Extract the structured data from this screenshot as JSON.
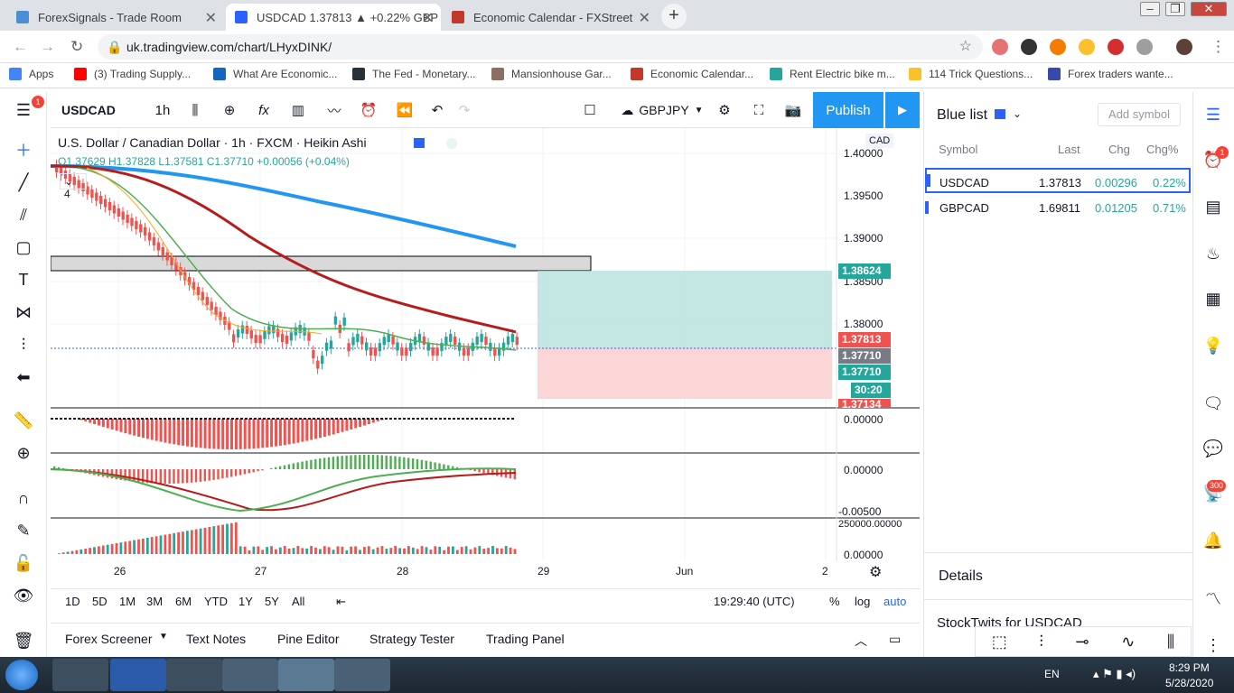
{
  "browser": {
    "tabs": [
      {
        "title": "ForexSignals - Trade Room",
        "active": false
      },
      {
        "title": "USDCAD 1.37813 ▲ +0.22% GBP",
        "active": true
      },
      {
        "title": "Economic Calendar - FXStreet",
        "active": false
      }
    ],
    "url": "uk.tradingview.com/chart/LHyxDINK/",
    "bookmarks": [
      "Apps",
      "(3) Trading Supply...",
      "What Are Economic...",
      "The Fed - Monetary...",
      "Mansionhouse Gar...",
      "Economic Calendar...",
      "Rent Electric bike m...",
      "114 Trick Questions...",
      "Forex traders wante..."
    ]
  },
  "toolbar": {
    "symbol": "USDCAD",
    "interval": "1h",
    "compare_symbol": "GBPJPY",
    "publish_label": "Publish"
  },
  "leftbar": {
    "alert_badge": "1"
  },
  "chart": {
    "title": "U.S. Dollar / Canadian Dollar · 1h · FXCM · Heikin Ashi",
    "ohlc": "O1.37629  H1.37828  L1.37581  C1.37710  +0.00056 (+0.04%)",
    "indicator_count": "4",
    "currency": "CAD",
    "price_ticks": [
      "1.40000",
      "1.39500",
      "1.39000",
      "1.38500",
      "1.38000"
    ],
    "price_labels": [
      {
        "text": "1.38624",
        "color": "#26a69a"
      },
      {
        "text": "1.37813",
        "color": "#ef5350"
      },
      {
        "text": "1.37710",
        "color": "#787b86"
      },
      {
        "text": "1.37710",
        "color": "#26a69a"
      },
      {
        "text": "30:20",
        "color": "#26a69a"
      },
      {
        "text": "1.37134",
        "color": "#ef5350"
      }
    ],
    "pane_labels": [
      "0.00000",
      "0.00000",
      "-0.00500",
      "250000.00000",
      "0.00000"
    ],
    "time_labels": [
      "26",
      "27",
      "28",
      "29",
      "Jun",
      "2"
    ]
  },
  "chart_data": {
    "type": "candlestick",
    "x": [
      "26",
      "27",
      "28",
      "29",
      "Jun",
      "2"
    ],
    "ylim": [
      1.371,
      1.4
    ],
    "series": [
      {
        "name": "EMA long",
        "color": "#2196f3"
      },
      {
        "name": "EMA mid",
        "color": "#b71c1c"
      },
      {
        "name": "EMA short",
        "color": "#4caf50"
      },
      {
        "name": "EMA fast",
        "color": "#f9a825"
      }
    ],
    "position_target": 1.38624,
    "position_entry": 1.37813,
    "position_stop": 1.37134,
    "last_close": 1.3771
  },
  "timeframes": {
    "items": [
      "1D",
      "5D",
      "1M",
      "3M",
      "6M",
      "YTD",
      "1Y",
      "5Y",
      "All"
    ],
    "clock": "19:29:40 (UTC)",
    "percent": "%",
    "log": "log",
    "auto": "auto"
  },
  "bottom_tabs": [
    "Forex Screener",
    "Text Notes",
    "Pine Editor",
    "Strategy Tester",
    "Trading Panel"
  ],
  "watchlist": {
    "title": "Blue list",
    "add_label": "Add symbol",
    "headers": {
      "symbol": "Symbol",
      "last": "Last",
      "chg": "Chg",
      "chgp": "Chg%"
    },
    "rows": [
      {
        "symbol": "USDCAD",
        "last": "1.37813",
        "chg": "0.00296",
        "chgp": "0.22%"
      },
      {
        "symbol": "GBPCAD",
        "last": "1.69811",
        "chg": "0.01205",
        "chgp": "0.71%"
      }
    ],
    "details_label": "Details",
    "stocktwits_label": "StockTwits for USDCAD"
  },
  "right_strip": {
    "badge_one": "1",
    "badge_300": "300"
  },
  "taskbar": {
    "lang": "EN",
    "time": "8:29 PM",
    "date": "5/28/2020"
  }
}
